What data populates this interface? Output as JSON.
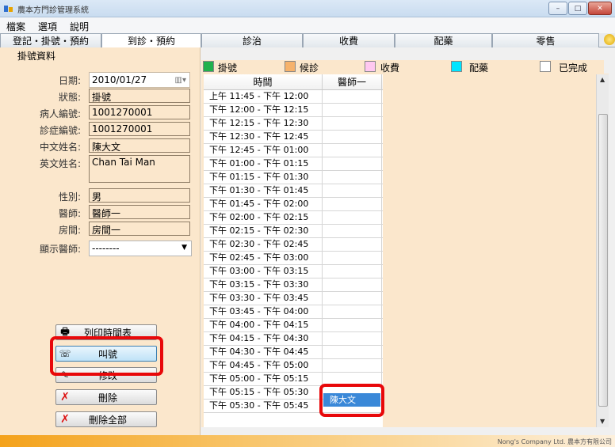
{
  "window": {
    "title": "農本方門診管理系統",
    "buttons": {
      "minimize": "–",
      "maximize": "□",
      "close": "✕"
    }
  },
  "menu": [
    "檔案",
    "選項",
    "說明"
  ],
  "tabs": [
    "登記・掛號・預約",
    "到診・預約",
    "診治",
    "收費",
    "配藥",
    "零售"
  ],
  "left": {
    "section_title": "掛號資料",
    "labels": {
      "date": "日期",
      "status": "狀態",
      "patient_no": "病人編號",
      "visit_no": "診症編號",
      "chinese_name": "中文姓名",
      "english_name": "英文姓名",
      "gender": "性別",
      "doctor": "醫師",
      "room": "房間",
      "show_doctor": "顯示醫師"
    },
    "values": {
      "date": "2010/01/27",
      "status": "掛號",
      "patient_no": "1001270001",
      "visit_no": "1001270001",
      "chinese_name": "陳大文",
      "english_name": "Chan Tai Man",
      "gender": "男",
      "doctor": "醫師一",
      "room": "房間一",
      "show_doctor": "--------"
    },
    "buttons": {
      "print": "列印時間表",
      "call": "叫號",
      "edit": "修改",
      "delete": "刪除",
      "delete_all": "刪除全部"
    }
  },
  "legend": [
    {
      "label": "掛號",
      "color": "#22b14c"
    },
    {
      "label": "候診",
      "color": "#f6b26b"
    },
    {
      "label": "收費",
      "color": "#ffc8f0"
    },
    {
      "label": "配藥",
      "color": "#00e5ff"
    },
    {
      "label": "已完成",
      "color": "#ffffff"
    }
  ],
  "schedule": {
    "headers": [
      "時間",
      "醫師一"
    ],
    "rows": [
      "上午 11:45 - 下午 12:00",
      "下午 12:00 - 下午 12:15",
      "下午 12:15 - 下午 12:30",
      "下午 12:30 - 下午 12:45",
      "下午 12:45 - 下午 01:00",
      "下午 01:00 - 下午 01:15",
      "下午 01:15 - 下午 01:30",
      "下午 01:30 - 下午 01:45",
      "下午 01:45 - 下午 02:00",
      "下午 02:00 - 下午 02:15",
      "下午 02:15 - 下午 02:30",
      "下午 02:30 - 下午 02:45",
      "下午 02:45 - 下午 03:00",
      "下午 03:00 - 下午 03:15",
      "下午 03:15 - 下午 03:30",
      "下午 03:30 - 下午 03:45",
      "下午 03:45 - 下午 04:00",
      "下午 04:00 - 下午 04:15",
      "下午 04:15 - 下午 04:30",
      "下午 04:30 - 下午 04:45",
      "下午 04:45 - 下午 05:00",
      "下午 05:00 - 下午 05:15",
      "下午 05:15 - 下午 05:30",
      "下午 05:30 - 下午 05:45"
    ],
    "booked_patient": "陳大文"
  },
  "footer": "Nong's Company Ltd.  農本方有限公司",
  "colors": {
    "panel_bg": "#fbe7cc",
    "highlight": "#e8080a",
    "selected": "#3a88d8"
  }
}
